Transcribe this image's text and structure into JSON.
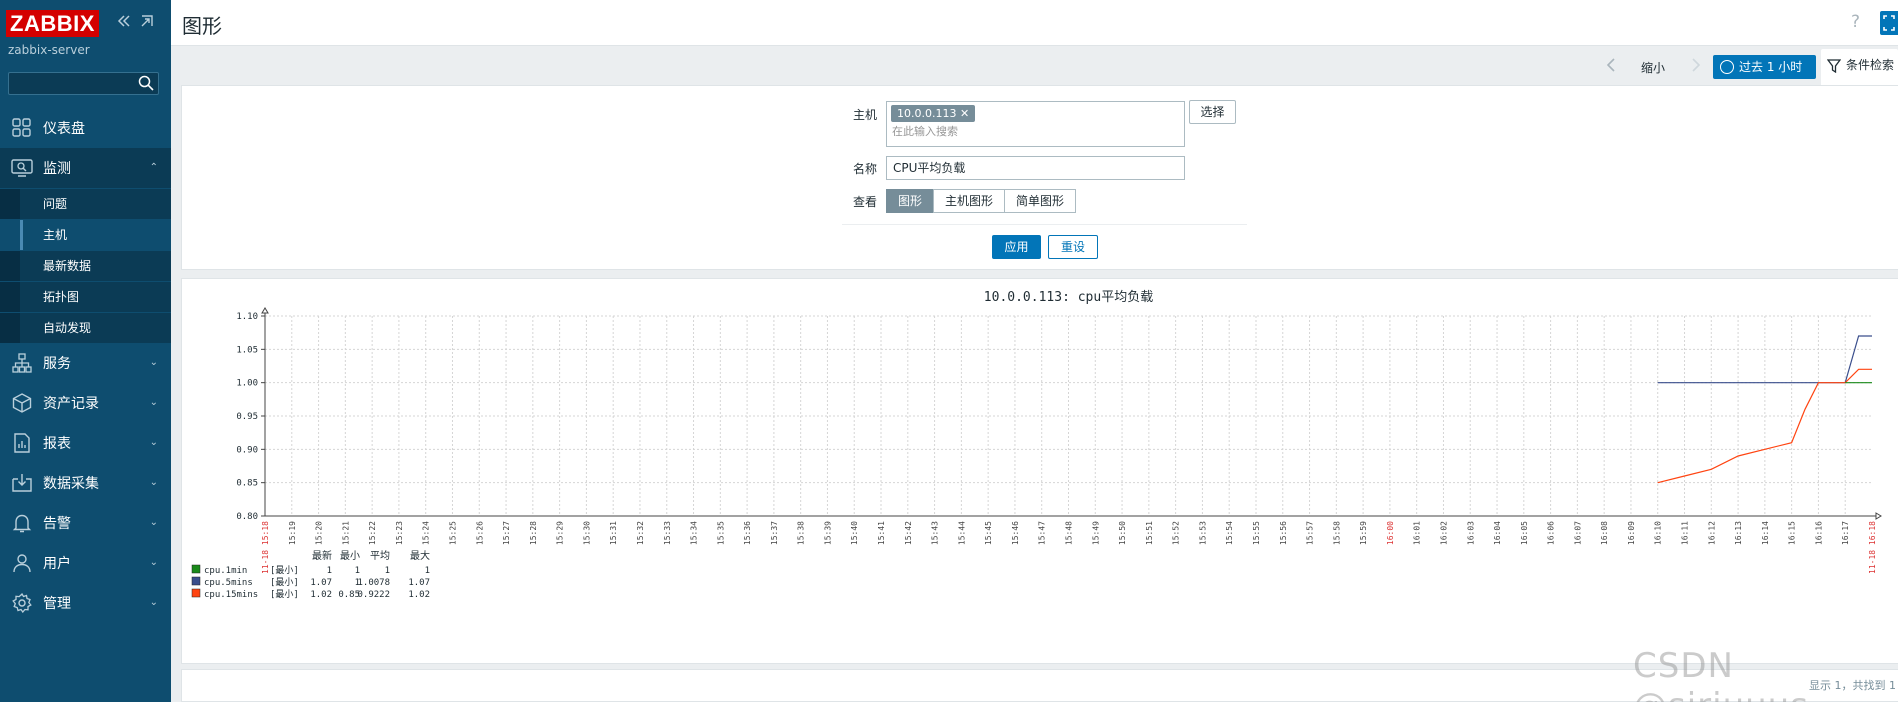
{
  "app": {
    "logo": "ZABBIX",
    "server_name": "zabbix-server"
  },
  "sidebar": {
    "menu": [
      {
        "label": "仪表盘",
        "icon": "dashboard-icon"
      },
      {
        "label": "监测",
        "icon": "monitoring-icon",
        "expanded": true,
        "children": [
          "问题",
          "主机",
          "最新数据",
          "拓扑图",
          "自动发现"
        ],
        "active_child": "主机"
      },
      {
        "label": "服务",
        "icon": "services-icon"
      },
      {
        "label": "资产记录",
        "icon": "inventory-icon"
      },
      {
        "label": "报表",
        "icon": "reports-icon"
      },
      {
        "label": "数据采集",
        "icon": "data-collection-icon"
      },
      {
        "label": "告警",
        "icon": "alerts-icon"
      },
      {
        "label": "用户",
        "icon": "users-icon"
      },
      {
        "label": "管理",
        "icon": "administration-icon"
      }
    ]
  },
  "header": {
    "title": "图形",
    "help": "?"
  },
  "timebar": {
    "zoom_out": "缩小",
    "period": "过去 1 小时",
    "filter": "条件检索"
  },
  "filter": {
    "host_label": "主机",
    "host_chip": "10.0.0.113 ✕",
    "host_placeholder": "在此输入搜索",
    "select_button": "选择",
    "name_label": "名称",
    "name_value": "CPU平均负载",
    "view_label": "查看",
    "view_options": [
      "图形",
      "主机图形",
      "简单图形"
    ],
    "view_selected": "图形",
    "apply": "应用",
    "reset": "重设"
  },
  "chart_data": {
    "type": "line",
    "title": "10.0.0.113: cpu平均负载",
    "ylim": [
      0.8,
      1.1
    ],
    "yticks": [
      "1.10",
      "1.05",
      "1.00",
      "0.95",
      "0.90",
      "0.85",
      "0.80"
    ],
    "x_start_label": "11-18 15:18",
    "x_end_label": "11-18 16:18",
    "x_ticks": [
      "15:19",
      "15:20",
      "15:21",
      "15:22",
      "15:23",
      "15:24",
      "15:25",
      "15:26",
      "15:27",
      "15:28",
      "15:29",
      "15:30",
      "15:31",
      "15:32",
      "15:33",
      "15:34",
      "15:35",
      "15:36",
      "15:37",
      "15:38",
      "15:39",
      "15:40",
      "15:41",
      "15:42",
      "15:43",
      "15:44",
      "15:45",
      "15:46",
      "15:47",
      "15:48",
      "15:49",
      "15:50",
      "15:51",
      "15:52",
      "15:53",
      "15:54",
      "15:55",
      "15:56",
      "15:57",
      "15:58",
      "15:59",
      "16:00",
      "16:01",
      "16:02",
      "16:03",
      "16:04",
      "16:05",
      "16:06",
      "16:07",
      "16:08",
      "16:09",
      "16:10",
      "16:11",
      "16:12",
      "16:13",
      "16:14",
      "16:15",
      "16:16",
      "16:17"
    ],
    "highlight_ticks": [
      "16:00"
    ],
    "series": [
      {
        "name": "cpu.1min",
        "color": "#1a8a1a",
        "points": [
          [
            "16:17",
            1.0
          ],
          [
            "16:18",
            1.0
          ]
        ]
      },
      {
        "name": "cpu.5mins",
        "color": "#3a4e8c",
        "points": [
          [
            "16:10",
            1.0
          ],
          [
            "16:17",
            1.0
          ],
          [
            "16:17.5",
            1.07
          ],
          [
            "16:18",
            1.07
          ]
        ]
      },
      {
        "name": "cpu.15mins",
        "color": "#ff4411",
        "points": [
          [
            "16:10",
            0.85
          ],
          [
            "16:11",
            0.86
          ],
          [
            "16:12",
            0.87
          ],
          [
            "16:13",
            0.89
          ],
          [
            "16:14",
            0.9
          ],
          [
            "16:15",
            0.91
          ],
          [
            "16:15.5",
            0.96
          ],
          [
            "16:16",
            1.0
          ],
          [
            "16:17",
            1.0
          ],
          [
            "16:17.5",
            1.02
          ],
          [
            "16:18",
            1.02
          ]
        ]
      }
    ],
    "legend": {
      "headers": [
        "最新",
        "最小",
        "平均",
        "最大"
      ],
      "rows": [
        {
          "name": "cpu.1min",
          "fn": "[最小]",
          "last": "1",
          "min": "1",
          "avg": "1",
          "max": "1",
          "color": "#1a8a1a"
        },
        {
          "name": "cpu.5mins",
          "fn": "[最小]",
          "last": "1.07",
          "min": "1",
          "avg": "1.0078",
          "max": "1.07",
          "color": "#3a4e8c"
        },
        {
          "name": "cpu.15mins",
          "fn": "[最小]",
          "last": "1.02",
          "min": "0.85",
          "avg": "0.9222",
          "max": "1.02",
          "color": "#ff4411"
        }
      ]
    },
    "grid": true
  },
  "footer": {
    "pager": "显示 1，共找到 1",
    "watermark": "CSDN @sirjuuus"
  }
}
